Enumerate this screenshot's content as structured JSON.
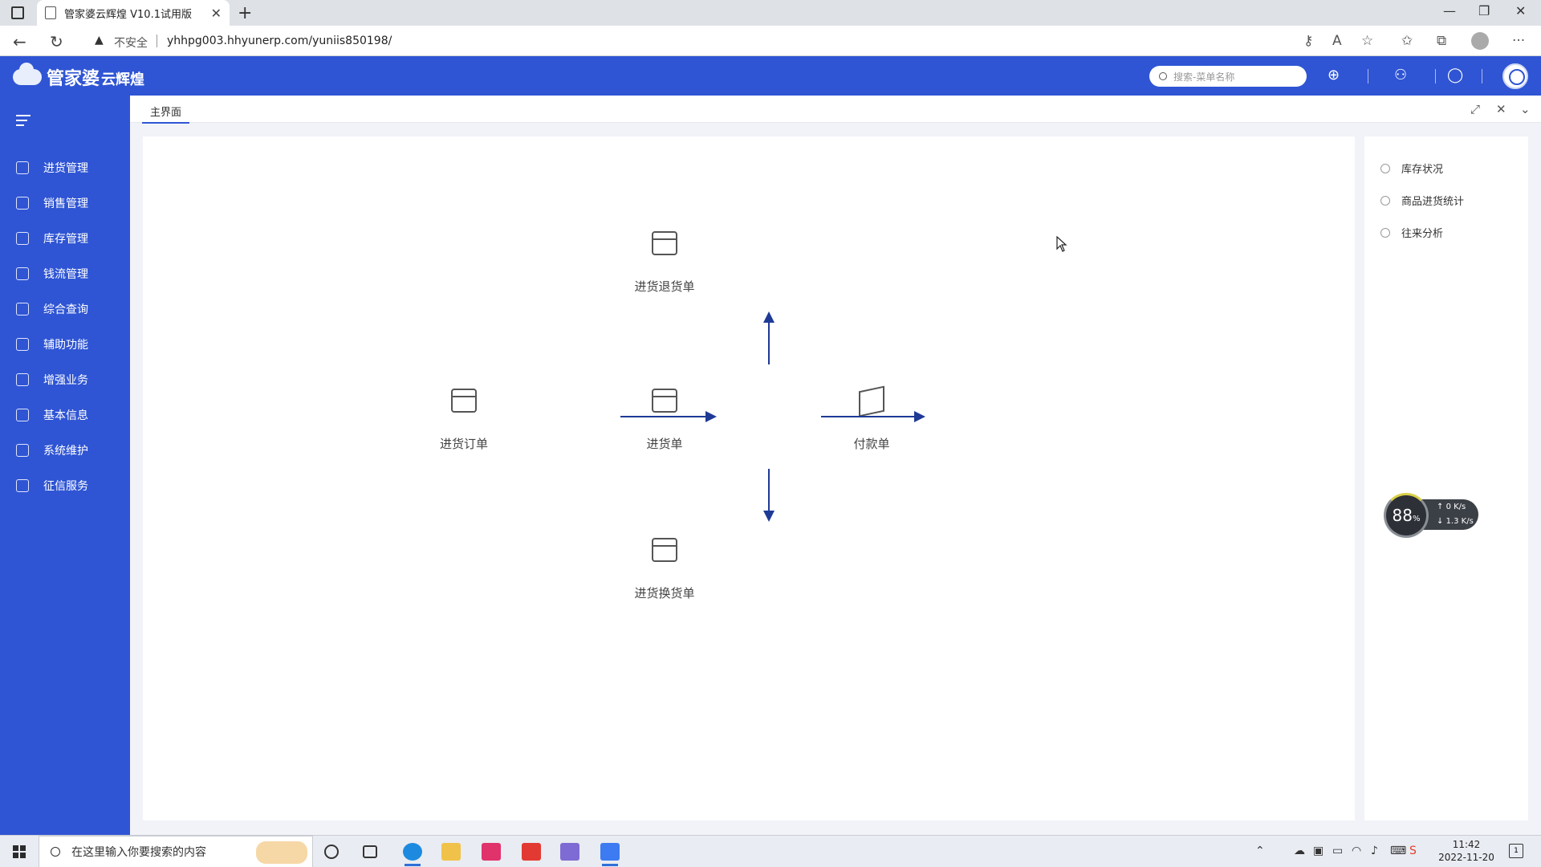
{
  "browser": {
    "tab_title": "管家婆云辉煌 V10.1试用版",
    "security_label": "不安全",
    "url": "yhhpg003.hhyunerp.com/yuniis850198/"
  },
  "header": {
    "logo_main": "管家婆",
    "logo_sub": "云辉煌",
    "search_placeholder": "搜索-菜单名称"
  },
  "sidebar": {
    "items": [
      {
        "label": "进货管理",
        "icon": "cart-icon"
      },
      {
        "label": "销售管理",
        "icon": "sales-chart-icon"
      },
      {
        "label": "库存管理",
        "icon": "inventory-box-icon"
      },
      {
        "label": "钱流管理",
        "icon": "money-bag-icon"
      },
      {
        "label": "综合查询",
        "icon": "query-search-icon"
      },
      {
        "label": "辅助功能",
        "icon": "auxiliary-icon"
      },
      {
        "label": "增强业务",
        "icon": "enhanced-business-icon"
      },
      {
        "label": "基本信息",
        "icon": "document-info-icon"
      },
      {
        "label": "系统维护",
        "icon": "system-maintenance-icon"
      },
      {
        "label": "征信服务",
        "icon": "credit-service-icon"
      }
    ]
  },
  "tabs": {
    "active": "主界面"
  },
  "flow": {
    "purchase_order": "进货订单",
    "purchase": "进货单",
    "purchase_return": "进货退货单",
    "purchase_exchange": "进货换货单",
    "payment": "付款单"
  },
  "quick_links": [
    {
      "label": "库存状况"
    },
    {
      "label": "商品进货统计"
    },
    {
      "label": "往来分析"
    }
  ],
  "speed_widget": {
    "percent": "88",
    "percent_unit": "%",
    "upload": "0",
    "upload_unit": "K/s",
    "download": "1.3",
    "download_unit": "K/s"
  },
  "taskbar": {
    "search_placeholder": "在这里输入你要搜索的内容",
    "time": "11:42",
    "date": "2022-11-20",
    "notification_count": "1"
  },
  "colors": {
    "brand_blue": "#2f55d4",
    "arrow_blue": "#1f3a96"
  }
}
